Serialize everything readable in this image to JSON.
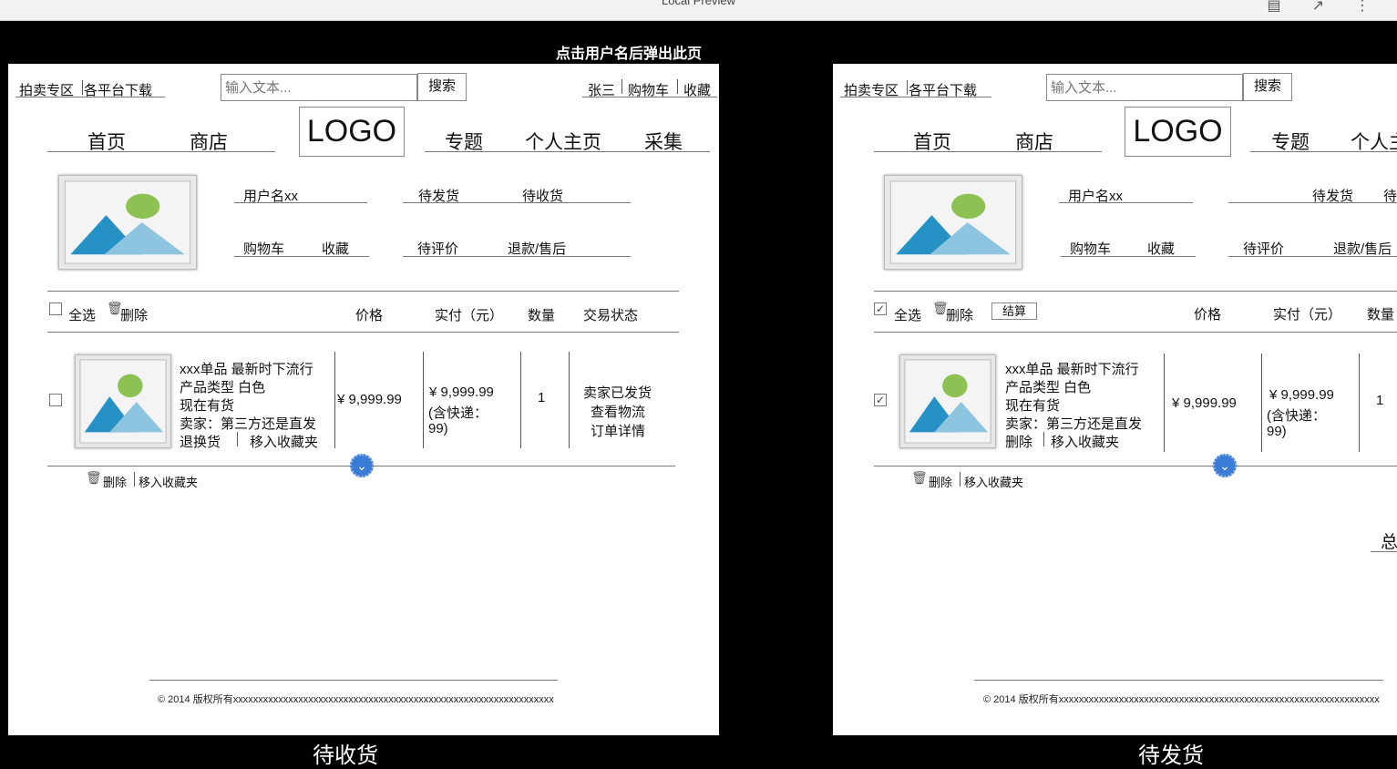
{
  "window": {
    "title": "Local Preview",
    "icons": [
      "document-icon",
      "export-icon",
      "more-icon"
    ]
  },
  "caption_top": "点击用户名后弹出此页",
  "left": {
    "caption": "待收货",
    "topnav": {
      "auction": "拍卖专区",
      "download": "各平台下载",
      "user": "张三",
      "cart": "购物车",
      "fav": "收藏"
    },
    "search": {
      "placeholder": "输入文本...",
      "button": "搜索"
    },
    "nav": {
      "home": "首页",
      "shop": "商店",
      "logo": "LOGO",
      "topic": "专题",
      "profile": "个人主页",
      "collect": "采集"
    },
    "user": {
      "name": "用户名xx",
      "cart": "购物车",
      "fav": "收藏",
      "to_ship": "待发货",
      "to_receive": "待收货",
      "to_review": "待评价",
      "refund": "退款/售后"
    },
    "table": {
      "select_all": "全选",
      "delete": "删除",
      "price": "价格",
      "paid": "实付（元）",
      "qty": "数量",
      "status": "交易状态"
    },
    "item": {
      "line1": "xxx单品 最新时下流行",
      "line2": "产品类型 白色",
      "line3": "现在有货",
      "line4": "卖家：第三方还是直发",
      "action1": "退换货",
      "action2": "移入收藏夹",
      "price": "¥ 9,999.99",
      "paid": "¥ 9,999.99",
      "paid_note1": "(含快递：",
      "paid_note2": "99)",
      "qty": "1",
      "status1": "卖家已发货",
      "status2": "查看物流",
      "status3": "订单详情"
    },
    "bottom": {
      "delete": "删除",
      "move": "移入收藏夹"
    },
    "footer": "© 2014 版权所有xxxxxxxxxxxxxxxxxxxxxxxxxxxxxxxxxxxxxxxxxxxxxxxxxxxxxxxxxxxxxxxx"
  },
  "right": {
    "caption": "待发货",
    "topnav": {
      "auction": "拍卖专区",
      "download": "各平台下载"
    },
    "search": {
      "placeholder": "输入文本...",
      "button": "搜索"
    },
    "nav": {
      "home": "首页",
      "shop": "商店",
      "logo": "LOGO",
      "topic": "专题",
      "profile": "个人主"
    },
    "user": {
      "name": "用户名xx",
      "cart": "购物车",
      "fav": "收藏",
      "to_ship": "待发货",
      "to_receive": "待",
      "to_review": "待评价",
      "refund": "退款/售后"
    },
    "table": {
      "select_all": "全选",
      "delete": "删除",
      "checkout": "结算",
      "price": "价格",
      "paid": "实付（元）",
      "qty": "数量"
    },
    "item": {
      "line1": "xxx单品 最新时下流行",
      "line2": "产品类型 白色",
      "line3": "现在有货",
      "line4": "卖家：第三方还是直发",
      "action1": "删除",
      "action2": "移入收藏夹",
      "price": "¥ 9,999.99",
      "paid": "¥ 9,999.99",
      "paid_note1": "(含快递：",
      "paid_note2": "99)",
      "qty": "1"
    },
    "bottom": {
      "delete": "删除",
      "move": "移入收藏夹"
    },
    "total": "总",
    "footer": "© 2014 版权所有xxxxxxxxxxxxxxxxxxxxxxxxxxxxxxxxxxxxxxxxxxxxxxxxxxxxxxxxxxxxxxxx"
  }
}
